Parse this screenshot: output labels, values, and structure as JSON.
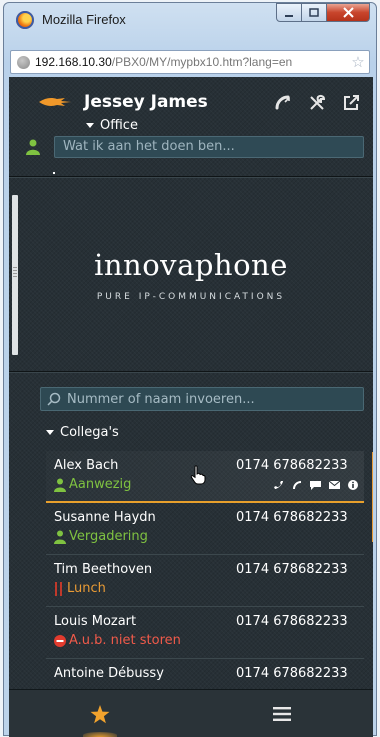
{
  "browser": {
    "title": "Mozilla Firefox",
    "url_host": "192.168.10.30",
    "url_path": "/PBX0/MY/mypbx10.htm?lang=en"
  },
  "profile": {
    "name": "Jessey James",
    "location": "Office",
    "status_placeholder": "Wat ik aan het doen ben..."
  },
  "logo": {
    "name": "innovaphone",
    "tagline": "PURE IP-COMMUNICATIONS"
  },
  "search": {
    "placeholder": "Nummer of naam invoeren..."
  },
  "group": {
    "label": "Collega's"
  },
  "contacts": [
    {
      "name": "Alex Bach",
      "number": "0174 678682233",
      "status": "Aanwezig",
      "status_icon": "person-icon",
      "status_color": "#7fc241"
    },
    {
      "name": "Susanne Haydn",
      "number": "0174 678682233",
      "status": "Vergadering",
      "status_icon": "person-icon",
      "status_color": "#7fc241"
    },
    {
      "name": "Tim Beethoven",
      "number": "0174 678682233",
      "status": "Lunch",
      "status_icon": "cutlery-icon",
      "status_color": "#e89a35"
    },
    {
      "name": "Louis Mozart",
      "number": "0174 678682233",
      "status": "A.u.b. niet storen",
      "status_icon": "do-not-disturb-icon",
      "status_color": "#f05a4a"
    },
    {
      "name": "Antoine Débussy",
      "number": "0174 678682233"
    }
  ],
  "colors": {
    "accent": "#e89a35",
    "background": "#273036",
    "available": "#7fc241"
  }
}
